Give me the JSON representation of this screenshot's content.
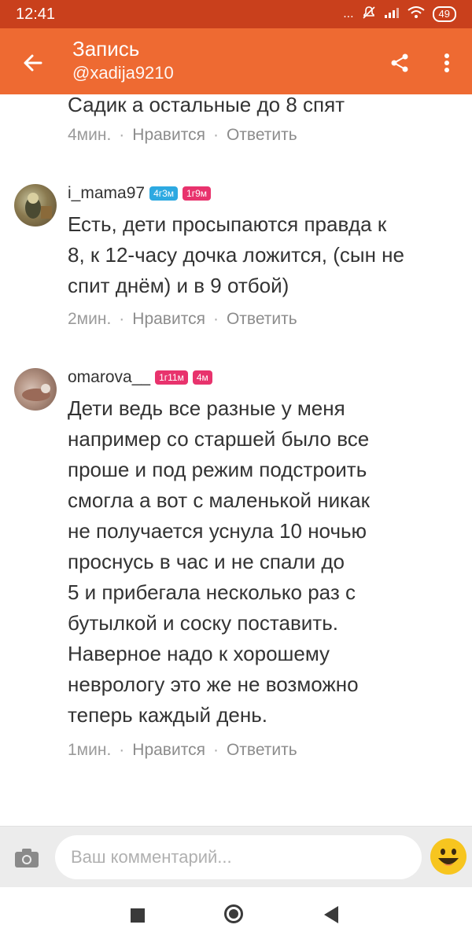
{
  "status": {
    "time": "12:41",
    "dots": "...",
    "battery": "49"
  },
  "header": {
    "title": "Запись",
    "subtitle": "@xadija9210"
  },
  "partial_comment": {
    "text": "Садик а остальные до 8 спят",
    "time": "4мин.",
    "like": "Нравится",
    "reply": "Ответить"
  },
  "comments": [
    {
      "author": "i_mama97",
      "badges": [
        "4г3м",
        "1г9м"
      ],
      "text_lines": [
        "Есть, дети просыпаются правда к",
        "8, к 12-часу дочка ложится, (сын не",
        "спит днём) и в 9 отбой)"
      ],
      "time": "2мин.",
      "like": "Нравится",
      "reply": "Ответить"
    },
    {
      "author": "omarova__",
      "badges": [
        "1г11м",
        "4м"
      ],
      "text_lines": [
        "Дети ведь все разные у меня",
        "например со старшей было все",
        "проше и под режим подстроить",
        "смогла а вот с маленькой никак",
        "не получается уснула 10 ночью",
        "проснусь в час и не спали до",
        "5 и прибегала несколько раз с",
        "бутылкой и соску поставить.",
        "Наверное надо к хорошему",
        "неврологу это же не возможно",
        "теперь каждый день."
      ],
      "time": "1мин.",
      "like": "Нравится",
      "reply": "Ответить"
    }
  ],
  "separator": "·",
  "input": {
    "placeholder": "Ваш комментарий..."
  },
  "colors": {
    "status_bar": "#c9401c",
    "app_bar": "#ee6a32",
    "badge_blue": "#2da9e1",
    "badge_pink": "#e8336d"
  },
  "icons": {
    "back": "arrow-left-icon",
    "share": "share-icon",
    "more": "more-vertical-icon",
    "camera": "camera-icon",
    "emoji": "smile-emoji-icon"
  }
}
